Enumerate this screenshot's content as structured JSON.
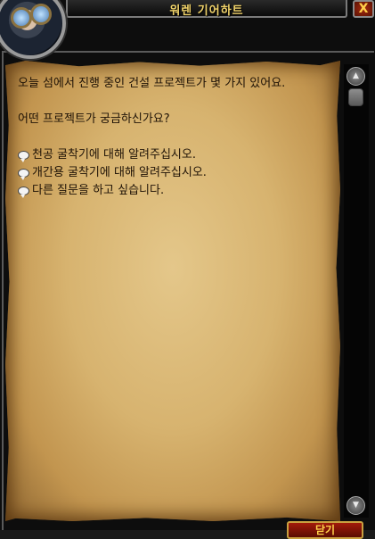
{
  "window": {
    "title": "워렌 기어하트",
    "close_label": "X"
  },
  "dialog": {
    "greeting": "오늘 섬에서 진행 중인 건설 프로젝트가 몇 가지 있어요.",
    "question": "어떤 프로젝트가 궁금하신가요?",
    "options": [
      {
        "label": "천공 굴착기에 대해 알려주십시오.",
        "icon": "chat-bubble-icon"
      },
      {
        "label": "개간용 굴착기에 대해 알려주십시오.",
        "icon": "chat-bubble-icon"
      },
      {
        "label": "다른 질문을 하고 싶습니다.",
        "icon": "chat-bubble-icon"
      }
    ]
  },
  "footer": {
    "button_label": "닫기"
  },
  "colors": {
    "title_text": "#f1d36a",
    "parchment": "#d7b36f",
    "body_text": "#1e1206",
    "button_red": "#a21a0a"
  }
}
